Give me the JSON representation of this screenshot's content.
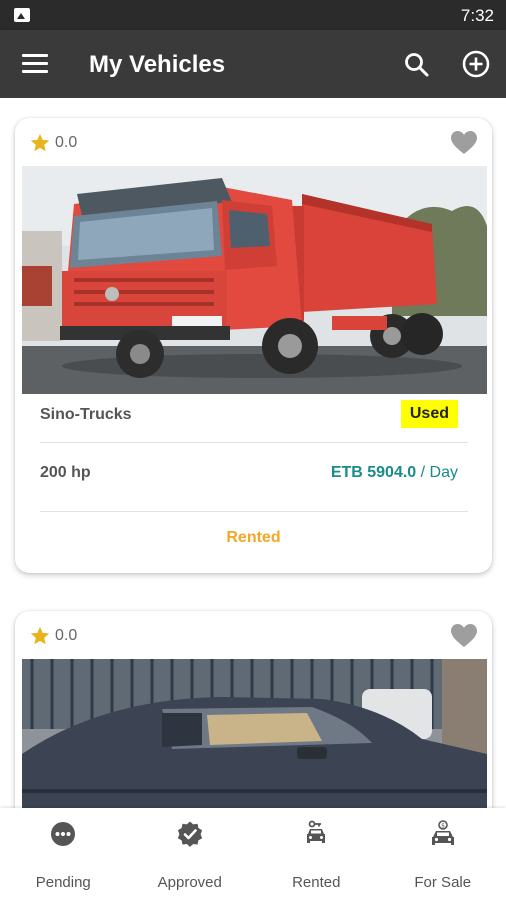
{
  "status_bar": {
    "time": "7:32",
    "left_icon": "image-icon"
  },
  "app_bar": {
    "title": "My Vehicles",
    "icons": [
      "menu-icon",
      "search-icon",
      "add-circle-icon"
    ]
  },
  "vehicles": [
    {
      "rating": "0.0",
      "name": "Sino-Trucks",
      "condition": "Used",
      "power": "200 hp",
      "price": "ETB 5904.0",
      "price_unit": " / Day",
      "status": "Rented",
      "photo": "red dump truck"
    },
    {
      "rating": "0.0",
      "photo": "dark grey sedan"
    }
  ],
  "bottom_nav": [
    {
      "label": "Pending",
      "icon": "more-horizontal-circle-icon"
    },
    {
      "label": "Approved",
      "icon": "verified-check-icon"
    },
    {
      "label": "Rented",
      "icon": "car-rental-icon"
    },
    {
      "label": "For Sale",
      "icon": "car-sale-icon"
    }
  ],
  "colors": {
    "app_bar": "#3a3a3a",
    "status_bar": "#2b2b2b",
    "price": "#1a8b8b",
    "status": "#f5a623",
    "badge": "#ffff00",
    "star": "#e8b41b"
  }
}
